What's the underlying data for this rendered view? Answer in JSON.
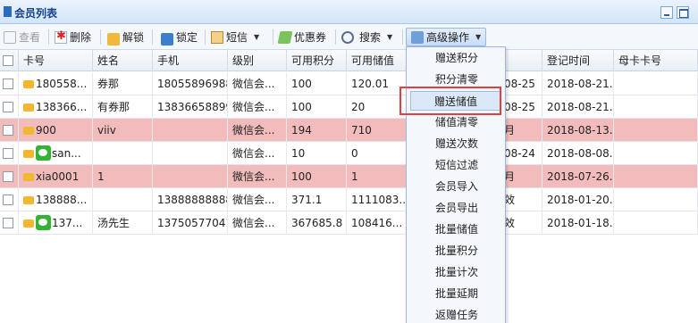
{
  "window": {
    "title": "会员列表"
  },
  "toolbar": {
    "view": "查看",
    "delete": "删除",
    "unlock": "解锁",
    "lock": "锁定",
    "sms": "短信",
    "coupon": "优惠券",
    "search": "搜索",
    "advanced": "高级操作"
  },
  "columns": [
    "卡号",
    "姓名",
    "手机",
    "级别",
    "可用积分",
    "可用储值",
    "",
    "登记时间",
    "母卡卡号"
  ],
  "rows": [
    {
      "card": "180558...",
      "name": "券那",
      "phone": "18055896988",
      "level": "微信会...",
      "points": "100",
      "balance": "120.01",
      "col7": "08-25",
      "reg": "2018-08-21...",
      "mother": "",
      "pink": false,
      "wechat": false
    },
    {
      "card": "138366...",
      "name": "有券那",
      "phone": "13836658899",
      "level": "微信会...",
      "points": "100",
      "balance": "20",
      "col7": "08-25",
      "reg": "2018-08-21...",
      "mother": "",
      "pink": false,
      "wechat": false
    },
    {
      "card": "900",
      "name": "viiv",
      "phone": "",
      "level": "微信会...",
      "points": "194",
      "balance": "710",
      "col7": "月",
      "reg": "2018-08-13...",
      "mother": "",
      "pink": true,
      "wechat": false
    },
    {
      "card": "san...",
      "name": "",
      "phone": "",
      "level": "微信会...",
      "points": "10",
      "balance": "0",
      "col7": "08-24",
      "reg": "2018-08-08...",
      "mother": "",
      "pink": false,
      "wechat": true
    },
    {
      "card": "xia0001",
      "name": "1",
      "phone": "",
      "level": "微信会...",
      "points": "100",
      "balance": "1",
      "col7": "月",
      "reg": "2018-07-26...",
      "mother": "",
      "pink": true,
      "wechat": false
    },
    {
      "card": "138888...",
      "name": "",
      "phone": "13888888888",
      "level": "微信会...",
      "points": "371.1",
      "balance": "1111083...",
      "col7": "效",
      "reg": "2018-01-20...",
      "mother": "",
      "pink": false,
      "wechat": false
    },
    {
      "card": "137...",
      "name": "汤先生",
      "phone": "13750577041",
      "level": "微信会...",
      "points": "367685.8",
      "balance": "108416...",
      "col7": "效",
      "reg": "2018-01-18...",
      "mother": "",
      "pink": false,
      "wechat": true
    }
  ],
  "menu": {
    "items": [
      "赠送积分",
      "积分清零",
      "赠送储值",
      "储值清零",
      "赠送次数",
      "短信过滤",
      "会员导入",
      "会员导出",
      "批量储值",
      "批量积分",
      "批量计次",
      "批量延期",
      "返赠任务"
    ],
    "highlighted_index": 2
  },
  "colors": {
    "pink_row": "#f3bcbc",
    "annotation": "#e24040",
    "accent": "#15428b"
  }
}
